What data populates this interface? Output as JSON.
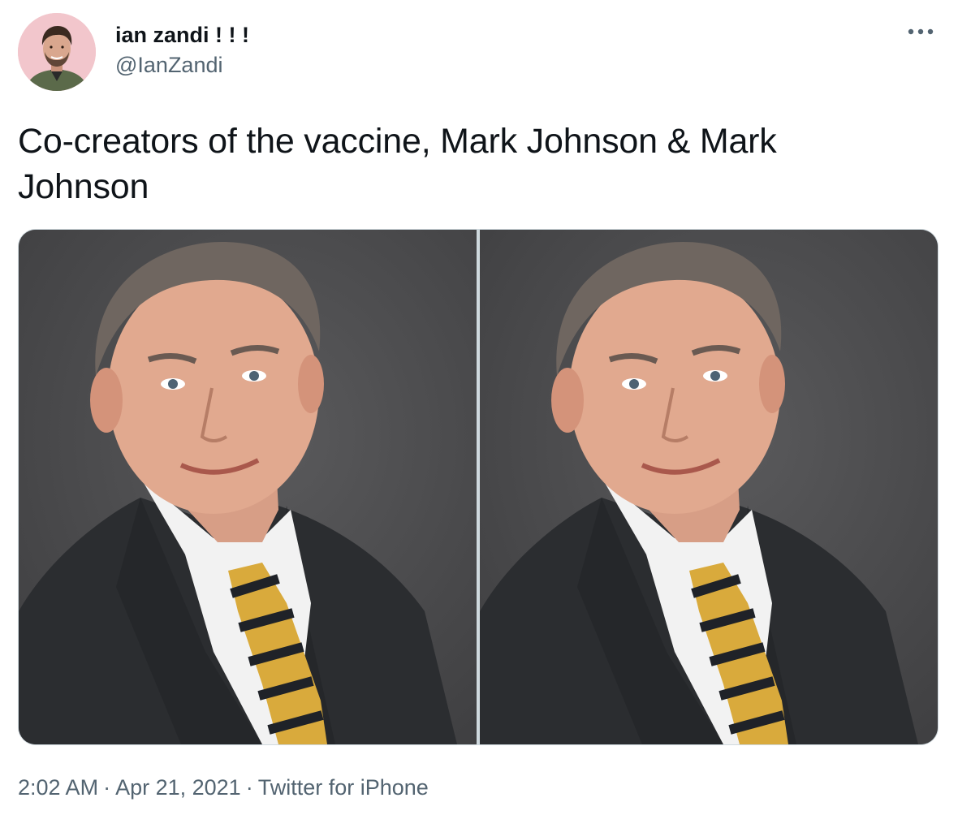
{
  "author": {
    "display_name": "ian zandi ! ! !",
    "handle": "@IanZandi"
  },
  "tweet": {
    "text": "Co-creators of the vaccine, Mark Johnson & Mark Johnson",
    "time": "2:02 AM",
    "date": "Apr 21, 2021",
    "source": "Twitter for iPhone",
    "separator": "·"
  },
  "icons": {
    "more": "more-options-icon",
    "avatar": "avatar"
  },
  "colors": {
    "text": "#0f1419",
    "secondary": "#536471",
    "border": "#cfd9de"
  }
}
